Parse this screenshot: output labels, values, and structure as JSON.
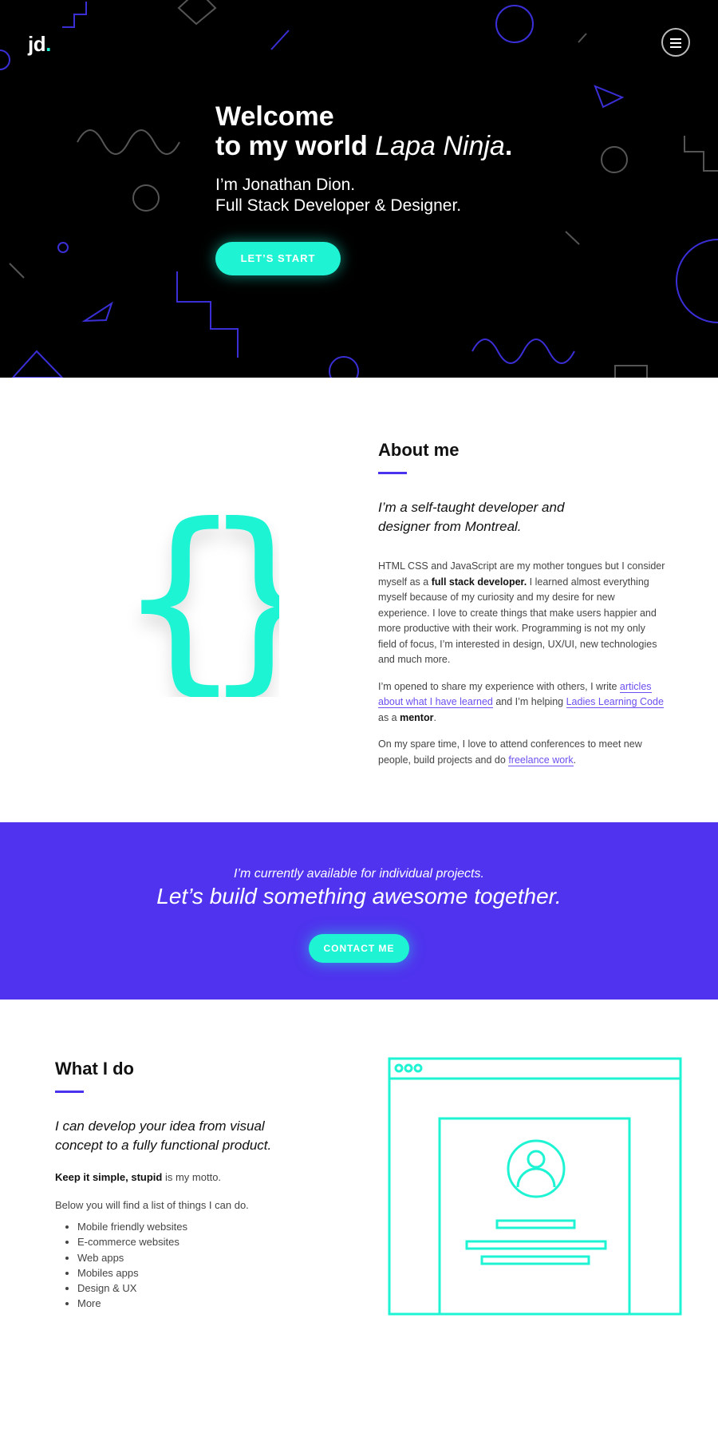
{
  "colors": {
    "accent_cyan": "#1ef4d3",
    "accent_purple": "#4f33ee",
    "hero_bg": "#000000"
  },
  "header": {
    "logo_text": "jd",
    "logo_dot": ".",
    "menu_icon": "hamburger-icon"
  },
  "hero": {
    "title_line1": "Welcome",
    "title_line2": "to my world",
    "title_brand": "Lapa Ninja",
    "title_period": ".",
    "subtitle_line1": "I’m Jonathan Dion.",
    "subtitle_line2": "Full Stack Developer & Designer.",
    "button_label": "LET’S START"
  },
  "about": {
    "heading": "About me",
    "icon": "curly-braces-icon",
    "lead_line1": "I’m a self-taught developer and",
    "lead_line2": "designer from Montreal.",
    "p1_a": "HTML CSS and JavaScript are my mother tongues but I consider myself as a ",
    "p1_bold": "full stack developer.",
    "p1_b": " I learned almost everything myself because of my curiosity and my desire for new experience. I love to create things that make users happier and more productive with their work. Programming is not my only field of focus, I’m interested in design, UX/UI, new technologies and much more.",
    "p2_a": "I’m opened to share my experience with others, I write ",
    "p2_link1": "articles about what I have learned",
    "p2_b": " and I’m helping ",
    "p2_link2": "Ladies Learning Code",
    "p2_c": " as a ",
    "p2_bold": "mentor",
    "p2_d": ".",
    "p3_a": "On my spare time, I love to attend conferences to meet new people, build projects and do ",
    "p3_link": "freelance work",
    "p3_b": "."
  },
  "cta": {
    "small": "I’m currently available for individual projects.",
    "big": "Let’s build something awesome together.",
    "button_label": "CONTACT ME"
  },
  "what": {
    "heading": "What I do",
    "lead_line1": "I can develop your idea from visual",
    "lead_line2": "concept to a fully functional product.",
    "motto_bold": "Keep it simple, stupid",
    "motto_rest": " is my motto.",
    "intro": "Below you will find a list of things I can do.",
    "items": [
      "Mobile friendly websites",
      "E-commerce websites",
      "Web apps",
      "Mobiles apps",
      "Design & UX",
      "More"
    ],
    "illustration": "browser-profile-icon"
  }
}
